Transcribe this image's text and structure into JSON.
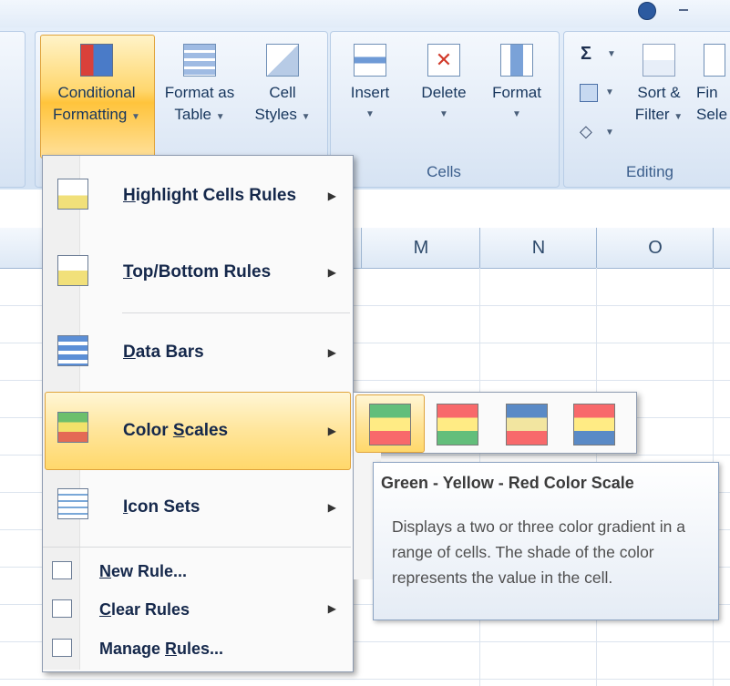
{
  "ribbon": {
    "conditional_formatting": {
      "line1": "Conditional",
      "line2": "Formatting"
    },
    "format_as_table": {
      "line1": "Format as",
      "line2": "Table"
    },
    "cell_styles": {
      "line1": "Cell",
      "line2": "Styles"
    },
    "insert": "Insert",
    "delete": "Delete",
    "format": "Format",
    "cells_group": "Cells",
    "sort_filter": {
      "line1": "Sort &",
      "line2": "Filter"
    },
    "find_select": {
      "line1": "Fin",
      "line2": "Sele"
    },
    "editing_group": "Editing",
    "sigma_symbol": "Σ"
  },
  "columns": [
    "M",
    "N",
    "O"
  ],
  "menu": {
    "items": [
      {
        "pre": "",
        "ul": "H",
        "post": "ighlight Cells Rules",
        "icon": "highlight-cells-icon"
      },
      {
        "pre": "",
        "ul": "T",
        "post": "op/Bottom Rules",
        "icon": "top-bottom-icon"
      },
      {
        "pre": "",
        "ul": "D",
        "post": "ata Bars",
        "icon": "data-bars-icon"
      },
      {
        "pre": "Color ",
        "ul": "S",
        "post": "cales",
        "icon": "color-scales-icon"
      },
      {
        "pre": "",
        "ul": "I",
        "post": "con Sets",
        "icon": "icon-sets-icon"
      }
    ],
    "small_items": [
      {
        "pre": "",
        "ul": "N",
        "post": "ew Rule...",
        "icon": "new-rule-icon"
      },
      {
        "pre": "",
        "ul": "C",
        "post": "lear Rules",
        "icon": "clear-rules-icon"
      },
      {
        "pre": "Manage ",
        "ul": "R",
        "post": "ules...",
        "icon": "manage-rules-icon"
      }
    ]
  },
  "tooltip": {
    "title": "Green - Yellow - Red Color Scale",
    "body": "Displays a two or three color gradient in a range of cells. The shade of the color represents the value in the cell."
  },
  "colors": {
    "highlight": "#ffd86b",
    "ribbon": "#dbe7f5",
    "menu_text": "#15284b"
  }
}
